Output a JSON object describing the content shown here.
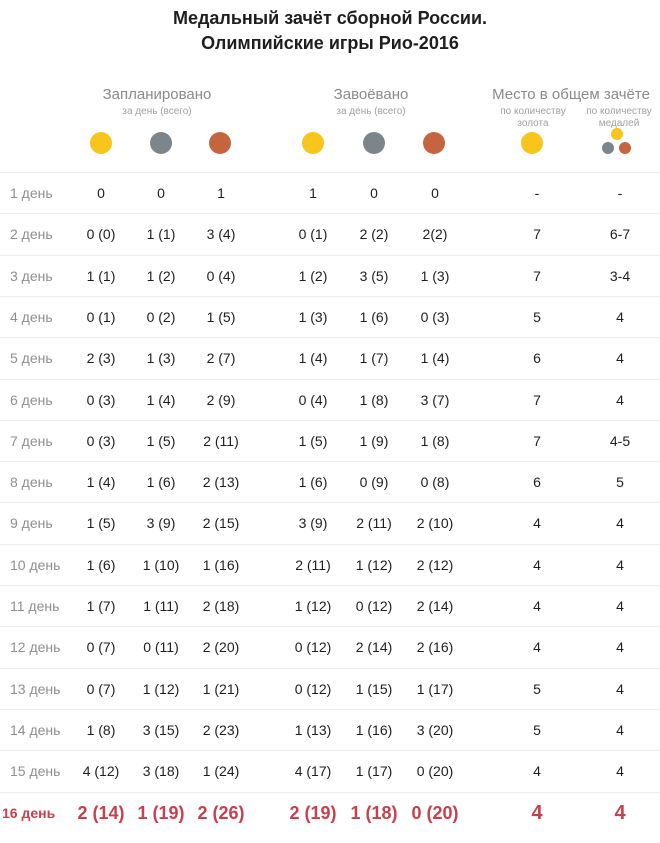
{
  "title": {
    "line1": "Медальный зачёт сборной России.",
    "line2": "Олимпийские игры Рио-2016"
  },
  "groups": {
    "planned": {
      "label": "Запланировано",
      "sub": "за день (всего)"
    },
    "won": {
      "label": "Завоёвано",
      "sub": "за день (всего)"
    },
    "place": {
      "label": "Место в общем зачёте",
      "gold_sub_1": "по количеству",
      "gold_sub_2": "золота",
      "total_sub_1": "по количеству",
      "total_sub_2": "медалей"
    }
  },
  "colors": {
    "gold": "#f7c51c",
    "silver": "#7c858b",
    "bronze": "#c5653f",
    "highlight": "#c8404e"
  },
  "rows": [
    {
      "day": "1 день",
      "pg": "0",
      "ps": "0",
      "pb": "1",
      "wg": "1",
      "ws": "0",
      "wb": "0",
      "rg": "-",
      "rt": "-"
    },
    {
      "day": "2 день",
      "pg": "0 (0)",
      "ps": "1 (1)",
      "pb": "3 (4)",
      "wg": "0 (1)",
      "ws": "2 (2)",
      "wb": "2(2)",
      "rg": "7",
      "rt": "6-7"
    },
    {
      "day": "3 день",
      "pg": "1 (1)",
      "ps": "1 (2)",
      "pb": "0 (4)",
      "wg": "1 (2)",
      "ws": "3 (5)",
      "wb": "1 (3)",
      "rg": "7",
      "rt": "3-4"
    },
    {
      "day": "4 день",
      "pg": "0 (1)",
      "ps": "0 (2)",
      "pb": "1 (5)",
      "wg": "1 (3)",
      "ws": "1 (6)",
      "wb": "0 (3)",
      "rg": "5",
      "rt": "4"
    },
    {
      "day": "5 день",
      "pg": "2 (3)",
      "ps": "1 (3)",
      "pb": "2 (7)",
      "wg": "1 (4)",
      "ws": "1 (7)",
      "wb": "1 (4)",
      "rg": "6",
      "rt": "4"
    },
    {
      "day": "6 день",
      "pg": "0 (3)",
      "ps": "1 (4)",
      "pb": "2 (9)",
      "wg": "0 (4)",
      "ws": "1 (8)",
      "wb": "3 (7)",
      "rg": "7",
      "rt": "4"
    },
    {
      "day": "7 день",
      "pg": "0 (3)",
      "ps": "1 (5)",
      "pb": "2 (11)",
      "wg": "1 (5)",
      "ws": "1 (9)",
      "wb": "1 (8)",
      "rg": "7",
      "rt": "4-5"
    },
    {
      "day": "8 день",
      "pg": "1 (4)",
      "ps": "1 (6)",
      "pb": "2 (13)",
      "wg": "1 (6)",
      "ws": "0 (9)",
      "wb": "0 (8)",
      "rg": "6",
      "rt": "5"
    },
    {
      "day": "9 день",
      "pg": "1 (5)",
      "ps": "3 (9)",
      "pb": "2 (15)",
      "wg": "3 (9)",
      "ws": "2 (11)",
      "wb": "2 (10)",
      "rg": "4",
      "rt": "4"
    },
    {
      "day": "10 день",
      "pg": "1 (6)",
      "ps": "1 (10)",
      "pb": "1 (16)",
      "wg": "2 (11)",
      "ws": "1 (12)",
      "wb": "2 (12)",
      "rg": "4",
      "rt": "4"
    },
    {
      "day": "11 день",
      "pg": "1 (7)",
      "ps": "1 (11)",
      "pb": "2 (18)",
      "wg": "1 (12)",
      "ws": "0 (12)",
      "wb": "2 (14)",
      "rg": "4",
      "rt": "4"
    },
    {
      "day": "12 день",
      "pg": "0 (7)",
      "ps": "0 (11)",
      "pb": "2 (20)",
      "wg": "0 (12)",
      "ws": "2 (14)",
      "wb": "2 (16)",
      "rg": "4",
      "rt": "4"
    },
    {
      "day": "13 день",
      "pg": "0 (7)",
      "ps": "1 (12)",
      "pb": "1 (21)",
      "wg": "0 (12)",
      "ws": "1 (15)",
      "wb": "1 (17)",
      "rg": "5",
      "rt": "4"
    },
    {
      "day": "14 день",
      "pg": "1 (8)",
      "ps": "3 (15)",
      "pb": "2 (23)",
      "wg": "1 (13)",
      "ws": "1 (16)",
      "wb": "3 (20)",
      "rg": "5",
      "rt": "4"
    },
    {
      "day": "15 день",
      "pg": "4 (12)",
      "ps": "3 (18)",
      "pb": "1 (24)",
      "wg": "4 (17)",
      "ws": "1 (17)",
      "wb": "0 (20)",
      "rg": "4",
      "rt": "4"
    },
    {
      "day": "16 день",
      "pg": "2 (14)",
      "ps": "1 (19)",
      "pb": "2 (26)",
      "wg": "2 (19)",
      "ws": "1 (18)",
      "wb": "0 (20)",
      "rg": "4",
      "rt": "4"
    }
  ]
}
